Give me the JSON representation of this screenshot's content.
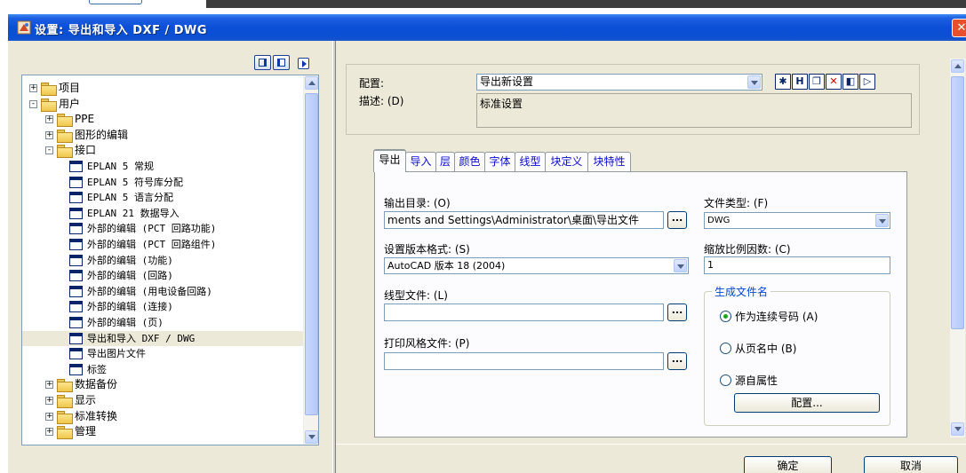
{
  "window": {
    "title": "设置: 导出和导入 DXF / DWG",
    "close_glyph": "✕"
  },
  "tree": {
    "items": [
      {
        "label": "项目",
        "level": 0,
        "type": "folder",
        "expander": "+"
      },
      {
        "label": "用户",
        "level": 0,
        "type": "folder",
        "expander": "−"
      },
      {
        "label": "PPE",
        "level": 1,
        "type": "folder",
        "expander": "+"
      },
      {
        "label": "图形的编辑",
        "level": 1,
        "type": "folder",
        "expander": "+"
      },
      {
        "label": "接口",
        "level": 1,
        "type": "folder",
        "expander": "−"
      },
      {
        "label": "EPLAN 5 常规",
        "level": 2,
        "type": "page"
      },
      {
        "label": "EPLAN 5 符号库分配",
        "level": 2,
        "type": "page"
      },
      {
        "label": "EPLAN 5 语言分配",
        "level": 2,
        "type": "page"
      },
      {
        "label": "EPLAN 21 数据导入",
        "level": 2,
        "type": "page"
      },
      {
        "label": "外部的编辑 (PCT 回路功能)",
        "level": 2,
        "type": "page"
      },
      {
        "label": "外部的编辑 (PCT 回路组件)",
        "level": 2,
        "type": "page"
      },
      {
        "label": "外部的编辑 (功能)",
        "level": 2,
        "type": "page"
      },
      {
        "label": "外部的编辑 (回路)",
        "level": 2,
        "type": "page"
      },
      {
        "label": "外部的编辑 (用电设备回路)",
        "level": 2,
        "type": "page"
      },
      {
        "label": "外部的编辑 (连接)",
        "level": 2,
        "type": "page"
      },
      {
        "label": "外部的编辑 (页)",
        "level": 2,
        "type": "page"
      },
      {
        "label": "导出和导入 DXF / DWG",
        "level": 2,
        "type": "page",
        "selected": true
      },
      {
        "label": "导出图片文件",
        "level": 2,
        "type": "page"
      },
      {
        "label": "标签",
        "level": 2,
        "type": "page"
      },
      {
        "label": "数据备份",
        "level": 1,
        "type": "folder",
        "expander": "+"
      },
      {
        "label": "显示",
        "level": 1,
        "type": "folder",
        "expander": "+"
      },
      {
        "label": "标准转换",
        "level": 1,
        "type": "folder",
        "expander": "+"
      },
      {
        "label": "管理",
        "level": 1,
        "type": "folder",
        "expander": "+"
      }
    ]
  },
  "config": {
    "profile_label": "配置:",
    "profile_value": "导出新设置",
    "desc_label": "描述: (D)",
    "desc_value": "标准设置"
  },
  "tabs": [
    {
      "label": "导出",
      "active": true
    },
    {
      "label": "导入"
    },
    {
      "label": "层"
    },
    {
      "label": "颜色"
    },
    {
      "label": "字体"
    },
    {
      "label": "线型"
    },
    {
      "label": "块定义"
    },
    {
      "label": "块特性"
    }
  ],
  "export": {
    "output_dir_label": "输出目录: (O)",
    "output_dir_value": "ments and Settings\\Administrator\\桌面\\导出文件",
    "file_type_label": "文件类型: (F)",
    "file_type_value": "DWG",
    "version_label": "设置版本格式: (S)",
    "version_value": "AutoCAD 版本 18 (2004)",
    "scale_label": "缩放比例因数: (C)",
    "scale_value": "1",
    "linetype_label": "线型文件: (L)",
    "linetype_value": "",
    "plotstyle_label": "打印风格文件: (P)",
    "plotstyle_value": "",
    "browse_label": "...",
    "filename_group_title": "生成文件名",
    "radio_options": [
      {
        "label": "作为连续号码 (A)",
        "checked": true
      },
      {
        "label": "从页名中 (B)",
        "checked": false
      },
      {
        "label": "源自属性",
        "checked": false
      }
    ],
    "config_button_label": "配置..."
  },
  "footer": {
    "ok_label": "确定",
    "cancel_label": "取消"
  }
}
